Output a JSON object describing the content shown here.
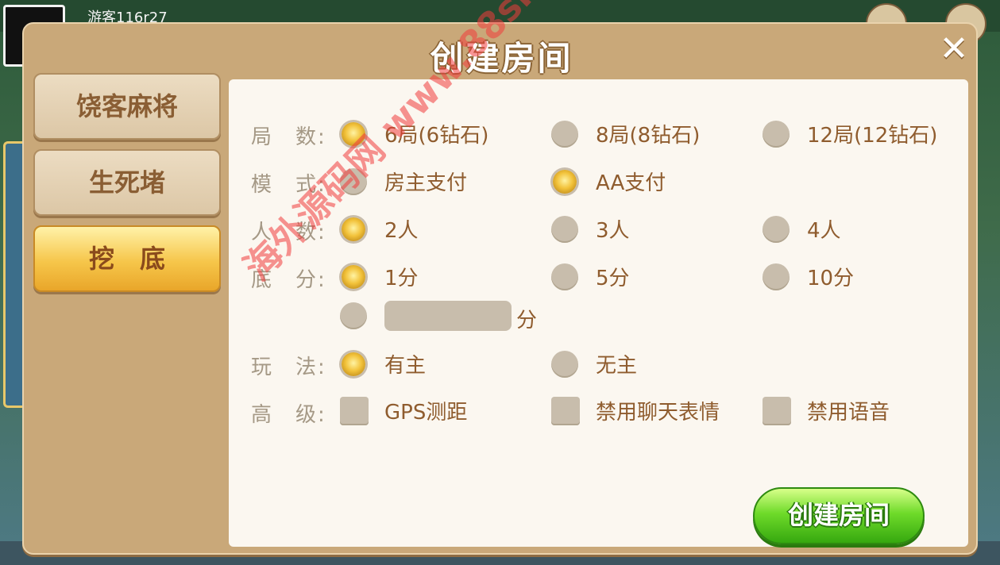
{
  "background": {
    "username": "游客116r27"
  },
  "dialog": {
    "title": "创建房间",
    "close_symbol": "✕"
  },
  "tabs": [
    {
      "label": "饶客麻将",
      "active": false
    },
    {
      "label": "生死堵",
      "active": false
    },
    {
      "label": "挖　底",
      "active": true
    }
  ],
  "rows": {
    "rounds": {
      "label": "局　数:",
      "options": [
        {
          "label": "6局(6钻石)",
          "selected": true
        },
        {
          "label": "8局(8钻石)",
          "selected": false
        },
        {
          "label": "12局(12钻石)",
          "selected": false
        }
      ]
    },
    "mode": {
      "label": "模　式:",
      "options": [
        {
          "label": "房主支付",
          "selected": false
        },
        {
          "label": "AA支付",
          "selected": true
        }
      ]
    },
    "players": {
      "label": "人　数:",
      "options": [
        {
          "label": "2人",
          "selected": true
        },
        {
          "label": "3人",
          "selected": false
        },
        {
          "label": "4人",
          "selected": false
        }
      ]
    },
    "base": {
      "label": "底　分:",
      "options": [
        {
          "label": "1分",
          "selected": true
        },
        {
          "label": "5分",
          "selected": false
        },
        {
          "label": "10分",
          "selected": false
        }
      ],
      "custom_unit": "分",
      "custom_value": ""
    },
    "play": {
      "label": "玩　法:",
      "options": [
        {
          "label": "有主",
          "selected": true
        },
        {
          "label": "无主",
          "selected": false
        }
      ]
    },
    "advanced": {
      "label": "高　级:",
      "options": [
        {
          "label": "GPS测距",
          "checked": false
        },
        {
          "label": "禁用聊天表情",
          "checked": false
        },
        {
          "label": "禁用语音",
          "checked": false
        }
      ]
    }
  },
  "create_button": "创建房间",
  "watermark": "海外源码网 www.88shops.top"
}
